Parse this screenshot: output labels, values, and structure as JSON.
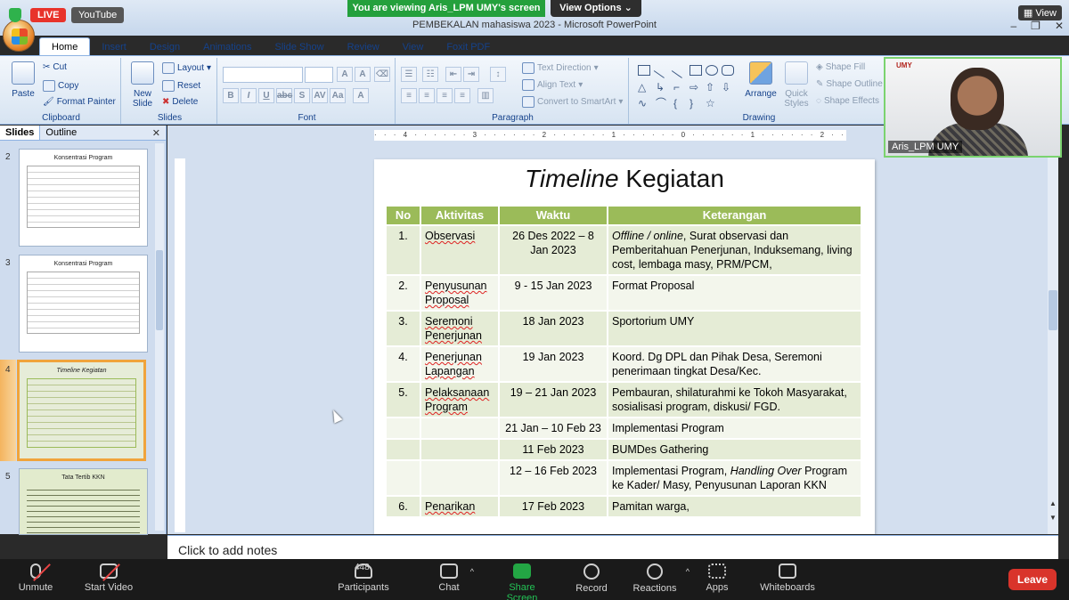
{
  "overlay": {
    "live": "LIVE",
    "youtube": "YouTube",
    "viewing_banner": "You are viewing Aris_LPM UMY's screen",
    "view_options": "View Options",
    "view": "View"
  },
  "window": {
    "title": "PEMBEKALAN mahasiswa 2023 - Microsoft PowerPoint"
  },
  "tabs": [
    "Home",
    "Insert",
    "Design",
    "Animations",
    "Slide Show",
    "Review",
    "View",
    "Foxit PDF"
  ],
  "ribbon": {
    "clipboard": {
      "paste": "Paste",
      "cut": "Cut",
      "copy": "Copy",
      "format_painter": "Format Painter",
      "label": "Clipboard"
    },
    "slides": {
      "new_slide": "New Slide",
      "layout": "Layout",
      "reset": "Reset",
      "delete": "Delete",
      "label": "Slides"
    },
    "font": {
      "label": "Font"
    },
    "paragraph": {
      "text_direction": "Text Direction",
      "align_text": "Align Text",
      "convert": "Convert to SmartArt",
      "label": "Paragraph"
    },
    "drawing": {
      "arrange": "Arrange",
      "quick_styles": "Quick Styles",
      "shape_fill": "Shape Fill",
      "shape_outline": "Shape Outline",
      "shape_effects": "Shape Effects",
      "label": "Drawing"
    }
  },
  "panel": {
    "tab_slides": "Slides",
    "tab_outline": "Outline",
    "thumbs": [
      {
        "num": "2",
        "title": "Konsentrasi Program"
      },
      {
        "num": "3",
        "title": "Konsentrasi Program"
      },
      {
        "num": "4",
        "title": "Timeline Kegiatan"
      },
      {
        "num": "5",
        "title": "Tata Tertib KKN"
      }
    ]
  },
  "ruler": "· · · 4 · · · · · · 3 · · · · · · 2 · · · · · · 1 · · · · · · 0 · · · · · · 1 · · · · · · 2 · · · · · · 3 · · · · · · 4 · · ·",
  "slide": {
    "title_italic": "Timeline",
    "title_rest": " Kegiatan",
    "headers": {
      "no": "No",
      "aktivitas": "Aktivitas",
      "waktu": "Waktu",
      "keterangan": "Keterangan"
    },
    "rows": [
      {
        "no": "1.",
        "aktivitas": "Observasi",
        "waktu": "26 Des 2022 – 8 Jan 2023",
        "ket_italic": "Offline / online",
        "ket": ", Surat observasi dan Pemberitahuan Penerjunan, Induksemang, living cost, lembaga masy, PRM/PCM,"
      },
      {
        "no": "2.",
        "aktivitas": "Penyusunan Proposal",
        "waktu": "9 - 15 Jan 2023",
        "ket_italic": "",
        "ket": "Format Proposal"
      },
      {
        "no": "3.",
        "aktivitas": "Seremoni Penerjunan",
        "waktu": "18 Jan 2023",
        "ket_italic": "",
        "ket": "Sportorium UMY"
      },
      {
        "no": "4.",
        "aktivitas": "Penerjunan Lapangan",
        "waktu": "19 Jan 2023",
        "ket_italic": "",
        "ket": "Koord. Dg DPL dan Pihak Desa, Seremoni penerimaan tingkat Desa/Kec."
      },
      {
        "no": "5.",
        "aktivitas": "Pelaksanaan Program",
        "waktu": "19 – 21 Jan 2023",
        "ket_italic": "",
        "ket": "Pembauran, shilaturahmi ke Tokoh Masyarakat, sosialisasi program, diskusi/ FGD."
      },
      {
        "no": "",
        "aktivitas": "",
        "waktu": "21 Jan – 10 Feb 23",
        "ket_italic": "",
        "ket": "Implementasi Program"
      },
      {
        "no": "",
        "aktivitas": "",
        "waktu": "11 Feb 2023",
        "ket_italic": "",
        "ket": "BUMDes Gathering"
      },
      {
        "no": "",
        "aktivitas": "",
        "waktu": "12 – 16 Feb 2023",
        "ket_pre": "Implementasi Program, ",
        "ket_italic": "Handling Over",
        "ket": " Program ke Kader/ Masy, Penyusunan  Laporan KKN"
      },
      {
        "no": "6.",
        "aktivitas": "Penarikan",
        "waktu": "17 Feb 2023",
        "ket_italic": "",
        "ket": "Pamitan warga,"
      }
    ]
  },
  "notes": "Click to add notes",
  "webcam": {
    "name": "Aris_LPM UMY",
    "logo": "UMY"
  },
  "zoom": {
    "unmute": "Unmute",
    "start_video": "Start Video",
    "participants": "Participants",
    "participant_count": "448",
    "chat": "Chat",
    "share_screen": "Share Screen",
    "record": "Record",
    "reactions": "Reactions",
    "apps": "Apps",
    "whiteboards": "Whiteboards",
    "leave": "Leave"
  }
}
